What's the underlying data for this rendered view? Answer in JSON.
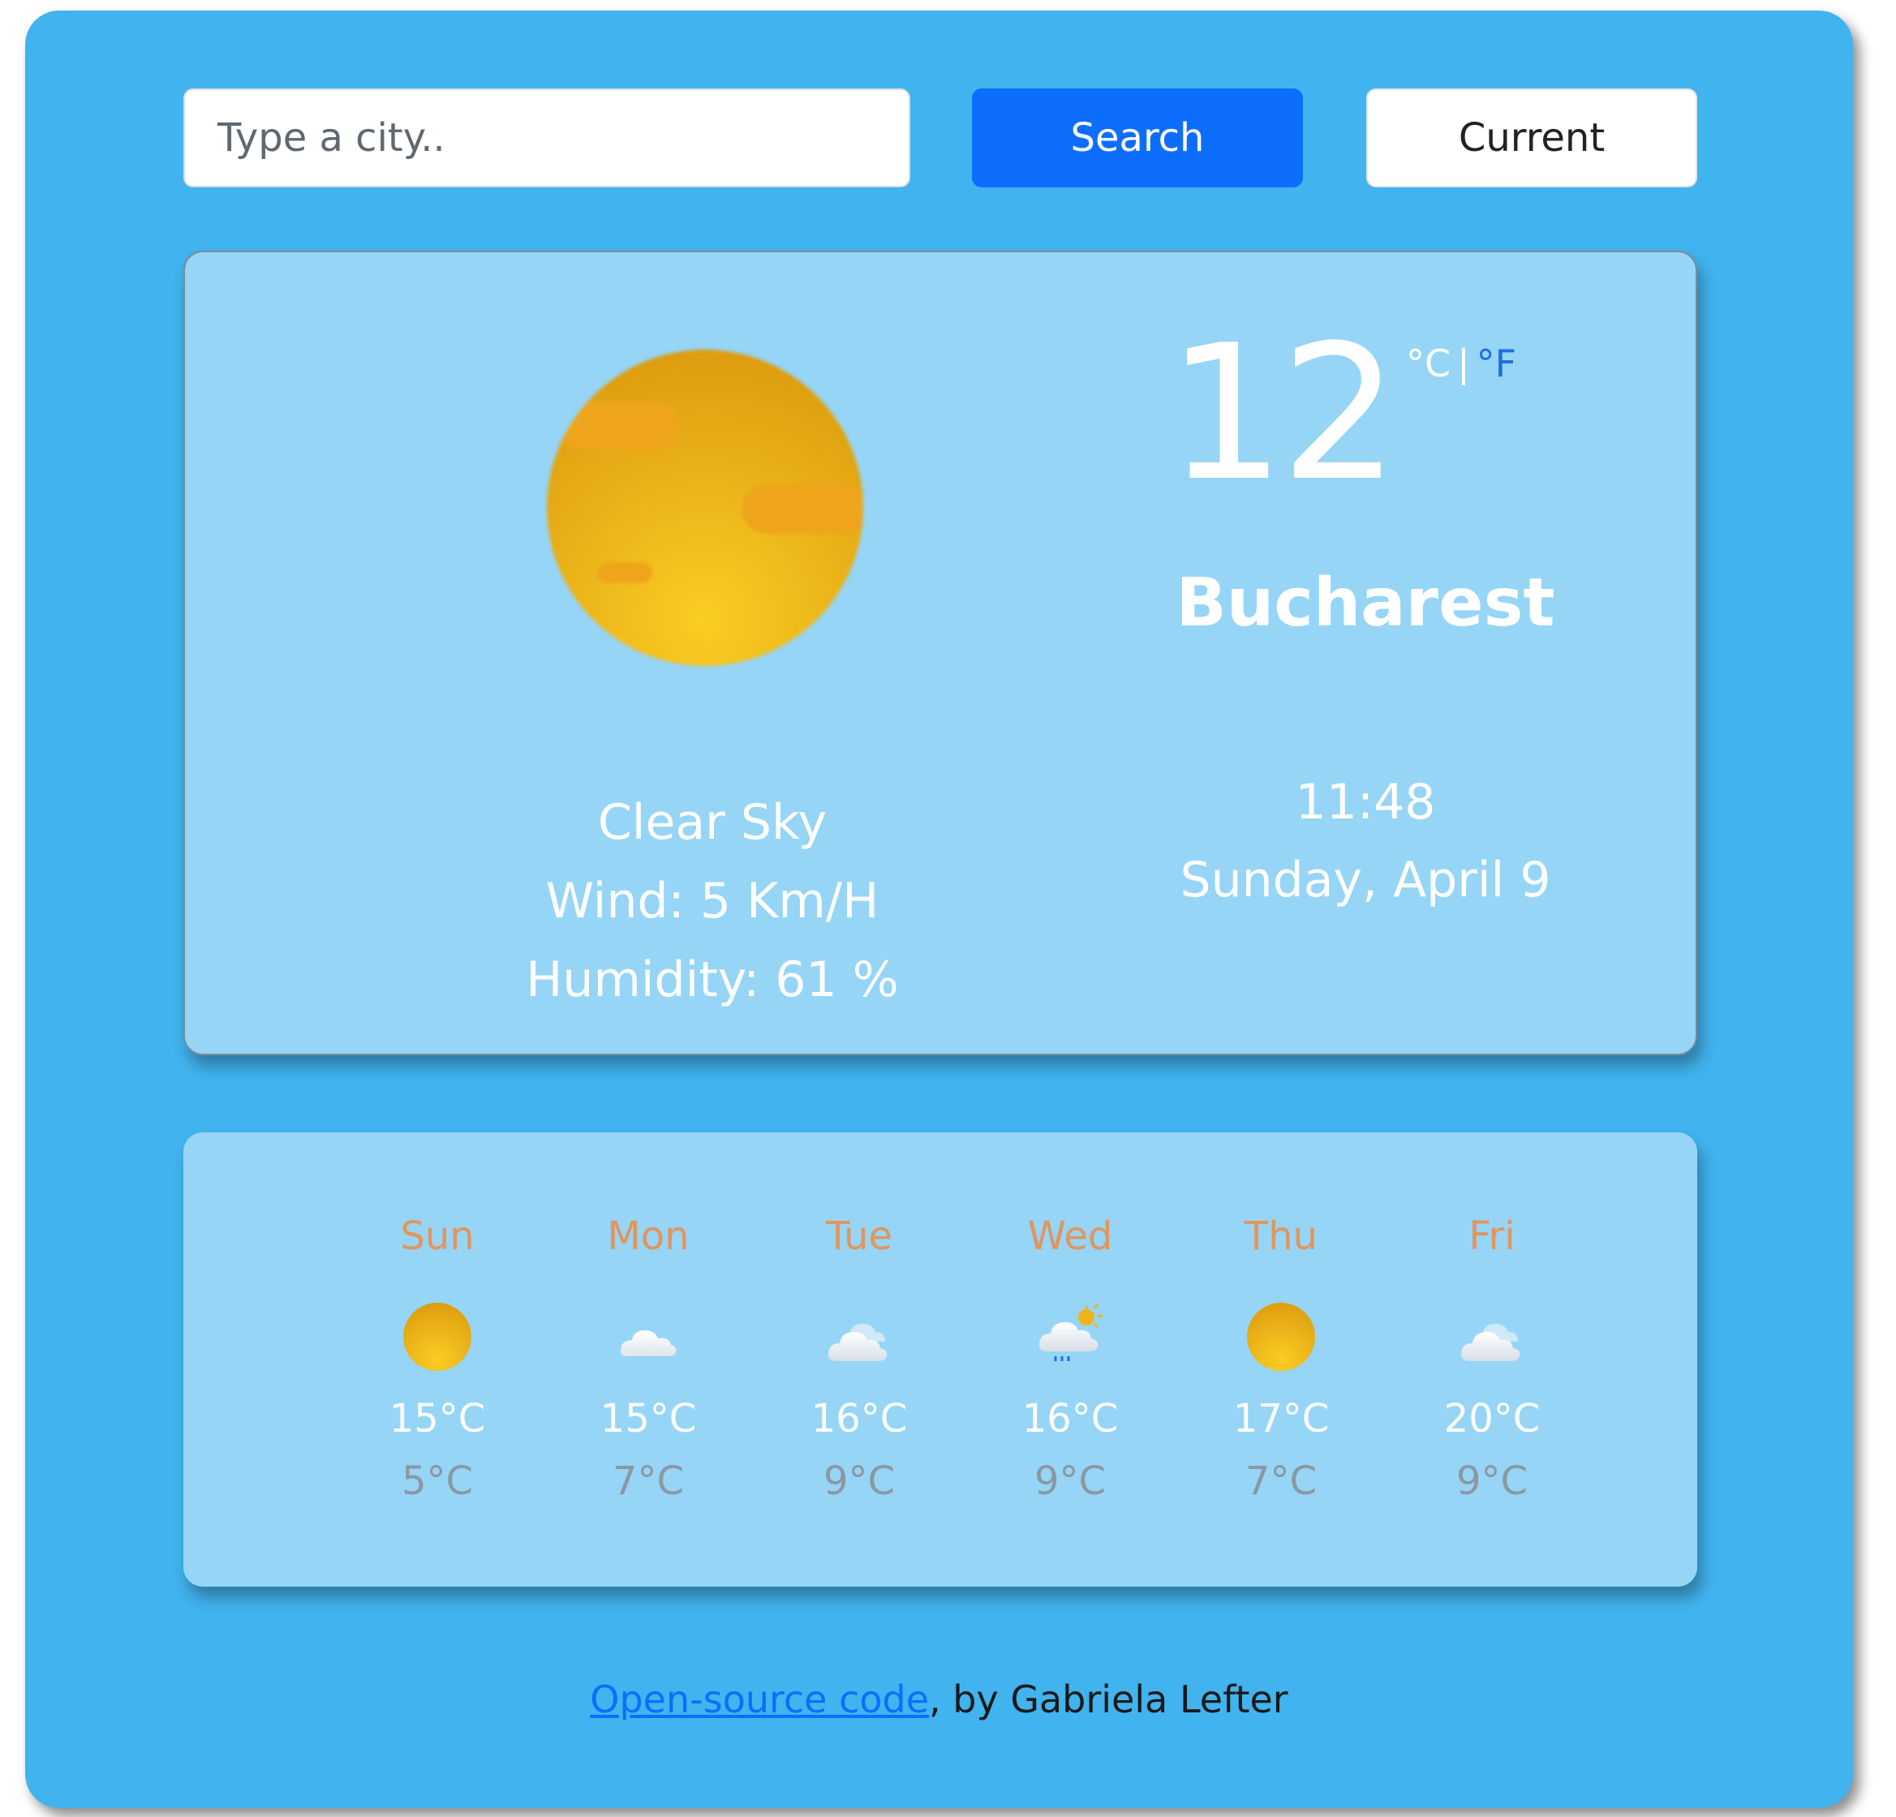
{
  "search": {
    "placeholder": "Type a city..",
    "search_label": "Search",
    "current_label": "Current"
  },
  "current": {
    "icon": "clear-sky-sun-icon",
    "temperature": "12",
    "unit_celsius": "°C",
    "unit_separator": "|",
    "unit_fahrenheit": "°F",
    "city": "Bucharest",
    "description": "Clear Sky",
    "wind": "Wind: 5 Km/H",
    "humidity": "Humidity: 61 %",
    "time": "11:48",
    "date": "Sunday, April 9"
  },
  "forecast": [
    {
      "day": "Sun",
      "icon": "sun-icon",
      "max": "15°C",
      "min": "5°C"
    },
    {
      "day": "Mon",
      "icon": "cloud-icon",
      "max": "15°C",
      "min": "7°C"
    },
    {
      "day": "Tue",
      "icon": "cloud-icon",
      "max": "16°C",
      "min": "9°C"
    },
    {
      "day": "Wed",
      "icon": "rain-sun-cloud-icon",
      "max": "16°C",
      "min": "9°C"
    },
    {
      "day": "Thu",
      "icon": "sun-icon",
      "max": "17°C",
      "min": "7°C"
    },
    {
      "day": "Fri",
      "icon": "cloud-icon",
      "max": "20°C",
      "min": "9°C"
    }
  ],
  "footer": {
    "link_text": "Open-source code",
    "suffix": ", by Gabriela Lefter"
  },
  "colors": {
    "app_background": "#41b3ee",
    "card_background": "#96d5f6",
    "primary_button": "#0d6efd",
    "day_name": "#e2955c",
    "min_temp": "#8a98a3",
    "sun": "#e7ad17"
  }
}
